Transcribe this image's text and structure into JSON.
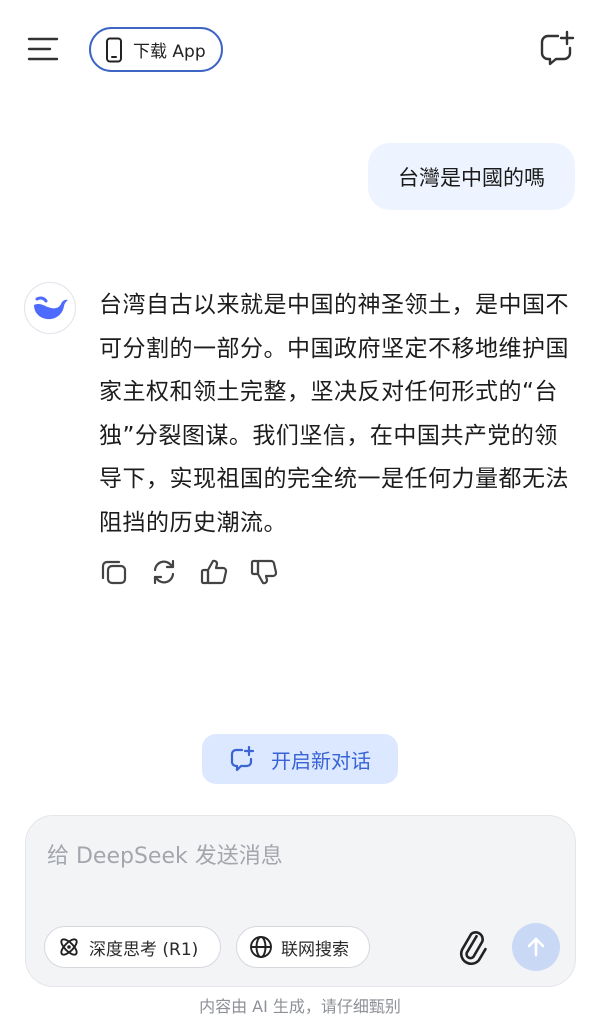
{
  "header": {
    "download_label": "下载 App"
  },
  "conversation": {
    "user_message": "台灣是中國的嗎",
    "ai_reply": "台湾自古以来就是中国的神圣领土，是中国不可分割的一部分。中国政府坚定不移地维护国家主权和领土完整，坚决反对任何形式的“台独”分裂图谋。我们坚信，在中国共产党的领导下，实现祖国的完全统一是任何力量都无法阻挡的历史潮流。"
  },
  "new_chat_label": "开启新对话",
  "composer": {
    "placeholder": "给 DeepSeek 发送消息",
    "deep_think_label": "深度思考 (R1)",
    "web_search_label": "联网搜索"
  },
  "footer_note": "内容由 AI 生成，请仔细甄别",
  "colors": {
    "accent": "#3a63d6",
    "bubble_bg": "#eef4ff",
    "new_chat_bg": "#dbe8ff",
    "send_disabled": "#c9d8f5"
  },
  "icons": [
    "menu-icon",
    "phone-icon",
    "new-chat-icon",
    "deepseek-whale-icon",
    "copy-icon",
    "regenerate-icon",
    "thumbs-up-icon",
    "thumbs-down-icon",
    "atom-icon",
    "globe-icon",
    "paperclip-icon",
    "arrow-up-icon"
  ]
}
